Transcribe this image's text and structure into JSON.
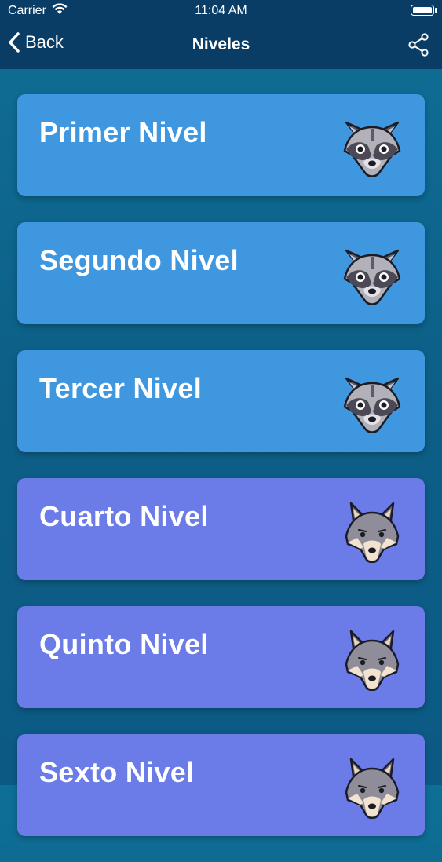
{
  "status_bar": {
    "carrier": "Carrier",
    "time": "11:04 AM"
  },
  "nav": {
    "back_label": "Back",
    "title": "Niveles"
  },
  "levels": [
    {
      "label": "Primer Nivel",
      "color": "#3f97e0",
      "icon": "raccoon-icon"
    },
    {
      "label": "Segundo Nivel",
      "color": "#3f97e0",
      "icon": "raccoon-icon"
    },
    {
      "label": "Tercer Nivel",
      "color": "#3f97e0",
      "icon": "raccoon-icon"
    },
    {
      "label": "Cuarto Nivel",
      "color": "#6b7be8",
      "icon": "wolf-icon"
    },
    {
      "label": "Quinto Nivel",
      "color": "#6b7be8",
      "icon": "wolf-icon"
    },
    {
      "label": "Sexto Nivel",
      "color": "#6b7be8",
      "icon": "wolf-icon"
    }
  ],
  "colors": {
    "header": "#0a3d66",
    "background": "#0e6f96"
  }
}
